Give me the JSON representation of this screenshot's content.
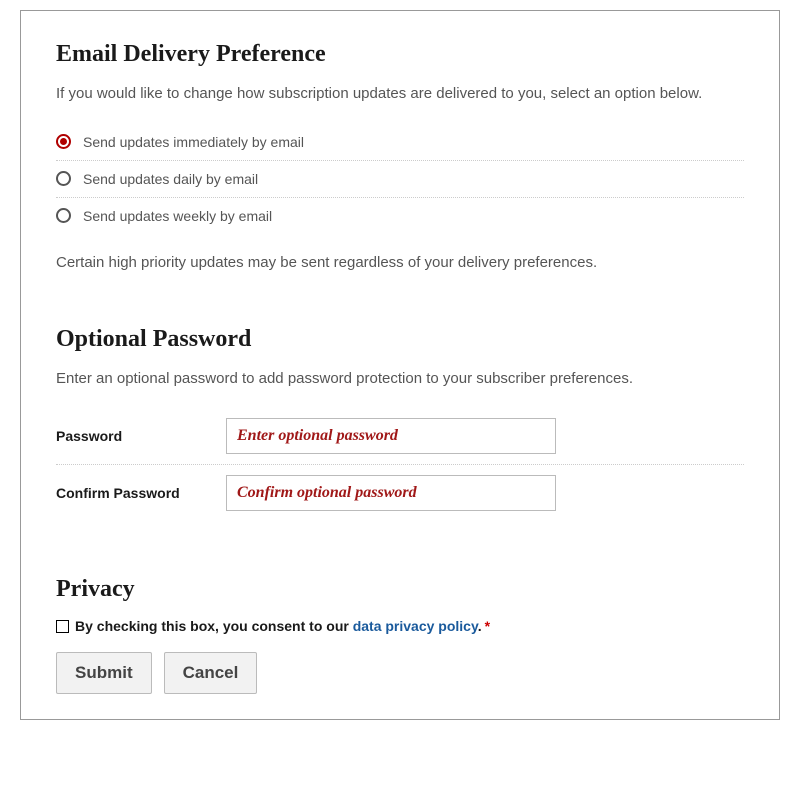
{
  "delivery": {
    "title": "Email Delivery Preference",
    "desc": "If you would like to change how subscription updates are delivered to you, select an option below.",
    "options": [
      {
        "label": "Send updates immediately by email",
        "selected": true
      },
      {
        "label": "Send updates daily by email",
        "selected": false
      },
      {
        "label": "Send updates weekly by email",
        "selected": false
      }
    ],
    "note": "Certain high priority updates may be sent regardless of your delivery preferences."
  },
  "password": {
    "title": "Optional Password",
    "desc": "Enter an optional password to add password protection to your subscriber preferences.",
    "field1_label": "Password",
    "field1_placeholder": "Enter optional password",
    "field2_label": "Confirm Password",
    "field2_placeholder": "Confirm optional password"
  },
  "privacy": {
    "title": "Privacy",
    "consent_prefix": "By checking this box, you consent to our ",
    "link_text": "data privacy policy",
    "period": ".",
    "required": "*"
  },
  "buttons": {
    "submit": "Submit",
    "cancel": "Cancel"
  }
}
